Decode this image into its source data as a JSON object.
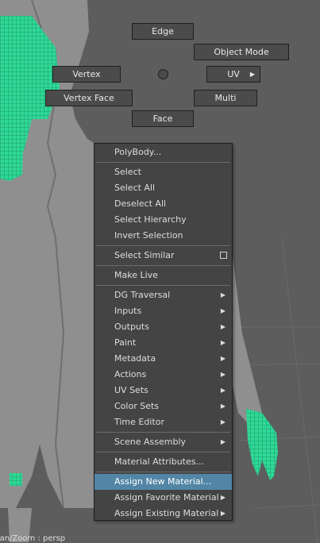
{
  "marking_menu": {
    "edge": "Edge",
    "object_mode": "Object Mode",
    "vertex": "Vertex",
    "uv": "UV",
    "vertex_face": "Vertex Face",
    "multi": "Multi",
    "face": "Face"
  },
  "context_menu": {
    "items": [
      {
        "label": "PolyBody...",
        "submenu": false,
        "separator_after": true
      },
      {
        "label": "Select",
        "submenu": false
      },
      {
        "label": "Select All",
        "submenu": false
      },
      {
        "label": "Deselect All",
        "submenu": false
      },
      {
        "label": "Select Hierarchy",
        "submenu": false
      },
      {
        "label": "Invert Selection",
        "submenu": false,
        "separator_after": true
      },
      {
        "label": "Select Similar",
        "submenu": false,
        "option_box": true,
        "separator_after": true
      },
      {
        "label": "Make Live",
        "submenu": false,
        "separator_after": true
      },
      {
        "label": "DG Traversal",
        "submenu": true
      },
      {
        "label": "Inputs",
        "submenu": true
      },
      {
        "label": "Outputs",
        "submenu": true
      },
      {
        "label": "Paint",
        "submenu": true
      },
      {
        "label": "Metadata",
        "submenu": true
      },
      {
        "label": "Actions",
        "submenu": true
      },
      {
        "label": "UV Sets",
        "submenu": true
      },
      {
        "label": "Color Sets",
        "submenu": true
      },
      {
        "label": "Time Editor",
        "submenu": true,
        "separator_after": true
      },
      {
        "label": "Scene Assembly",
        "submenu": true,
        "separator_after": true
      },
      {
        "label": "Material Attributes...",
        "submenu": false,
        "separator_after": true
      },
      {
        "label": "Assign New Material...",
        "submenu": false,
        "highlighted": true
      },
      {
        "label": "Assign Favorite Material",
        "submenu": true
      },
      {
        "label": "Assign Existing Material",
        "submenu": true
      }
    ]
  },
  "viewport": {
    "hud_text": "Pan/Zoom : persp",
    "selection_color": "#33f5a4",
    "mesh_color": "#8f8f8f",
    "background_color": "#5d5d5d"
  },
  "colors": {
    "highlight": "#5285a6",
    "menu_bg": "#444444"
  }
}
